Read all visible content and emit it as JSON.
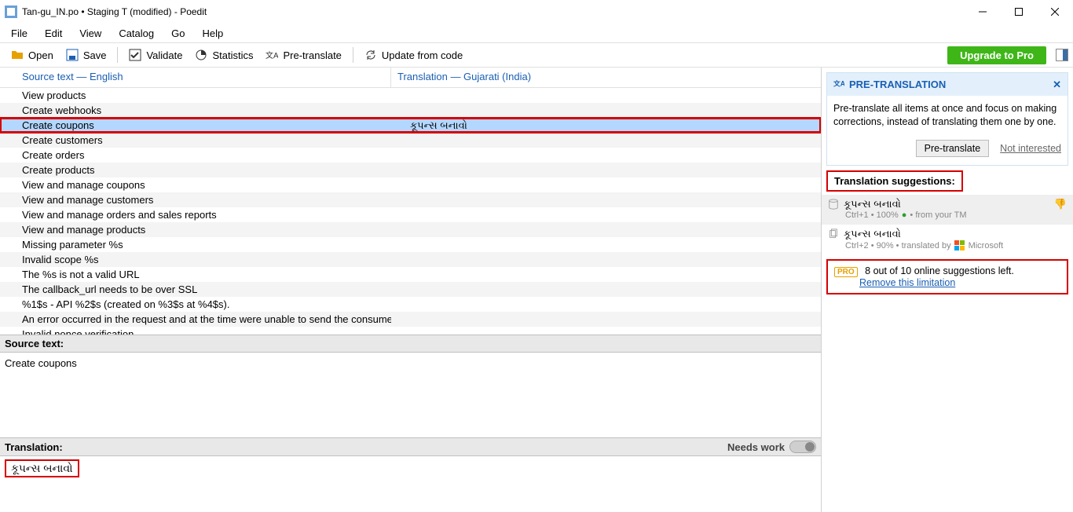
{
  "title": "Tan-gu_IN.po • Staging T (modified) - Poedit",
  "menu": {
    "file": "File",
    "edit": "Edit",
    "view": "View",
    "catalog": "Catalog",
    "go": "Go",
    "help": "Help"
  },
  "toolbar": {
    "open": "Open",
    "save": "Save",
    "validate": "Validate",
    "statistics": "Statistics",
    "pretranslate": "Pre-translate",
    "update": "Update from code",
    "upgrade": "Upgrade to Pro"
  },
  "columns": {
    "source": "Source text — English",
    "translation": "Translation — Gujarati (India)"
  },
  "rows": [
    {
      "src": "View products",
      "tr": ""
    },
    {
      "src": "Create webhooks",
      "tr": ""
    },
    {
      "src": "Create coupons",
      "tr": "કૂપન્સ બનાવો",
      "selected": true
    },
    {
      "src": "Create customers",
      "tr": ""
    },
    {
      "src": "Create orders",
      "tr": ""
    },
    {
      "src": "Create products",
      "tr": ""
    },
    {
      "src": "View and manage coupons",
      "tr": ""
    },
    {
      "src": "View and manage customers",
      "tr": ""
    },
    {
      "src": "View and manage orders and sales reports",
      "tr": ""
    },
    {
      "src": "View and manage products",
      "tr": ""
    },
    {
      "src": "Missing parameter %s",
      "tr": ""
    },
    {
      "src": "Invalid scope %s",
      "tr": ""
    },
    {
      "src": "The %s is not a valid URL",
      "tr": ""
    },
    {
      "src": "The callback_url needs to be over SSL",
      "tr": ""
    },
    {
      "src": "%1$s - API %2$s (created on %3$s at %4$s).",
      "tr": ""
    },
    {
      "src": "An error occurred in the request and at the time were unable to send the consumer data",
      "tr": ""
    },
    {
      "src": "Invalid nonce verification",
      "tr": ""
    }
  ],
  "sourceLabel": "Source text:",
  "sourceText": "Create coupons",
  "translationLabel": "Translation:",
  "needsWork": "Needs work",
  "translationText": "કૂપન્સ બનાવો",
  "preTrans": {
    "title": "PRE-TRANSLATION",
    "body": "Pre-translate all items at once and focus on making corrections, instead of translating them one by one.",
    "btn": "Pre-translate",
    "link": "Not interested"
  },
  "suggHeader": "Translation suggestions:",
  "sugg1": {
    "text": "કૂપન્સ બનાવો",
    "meta_a": "Ctrl+1 • 100% ",
    "meta_b": " • from your TM"
  },
  "sugg2": {
    "text": "કૂપન્સ બનાવો",
    "meta": "Ctrl+2 • 90% • translated by ",
    "provider": "Microsoft"
  },
  "pro": {
    "badge": "PRO",
    "text": "8 out of 10 online suggestions left.",
    "link": "Remove this limitation"
  }
}
